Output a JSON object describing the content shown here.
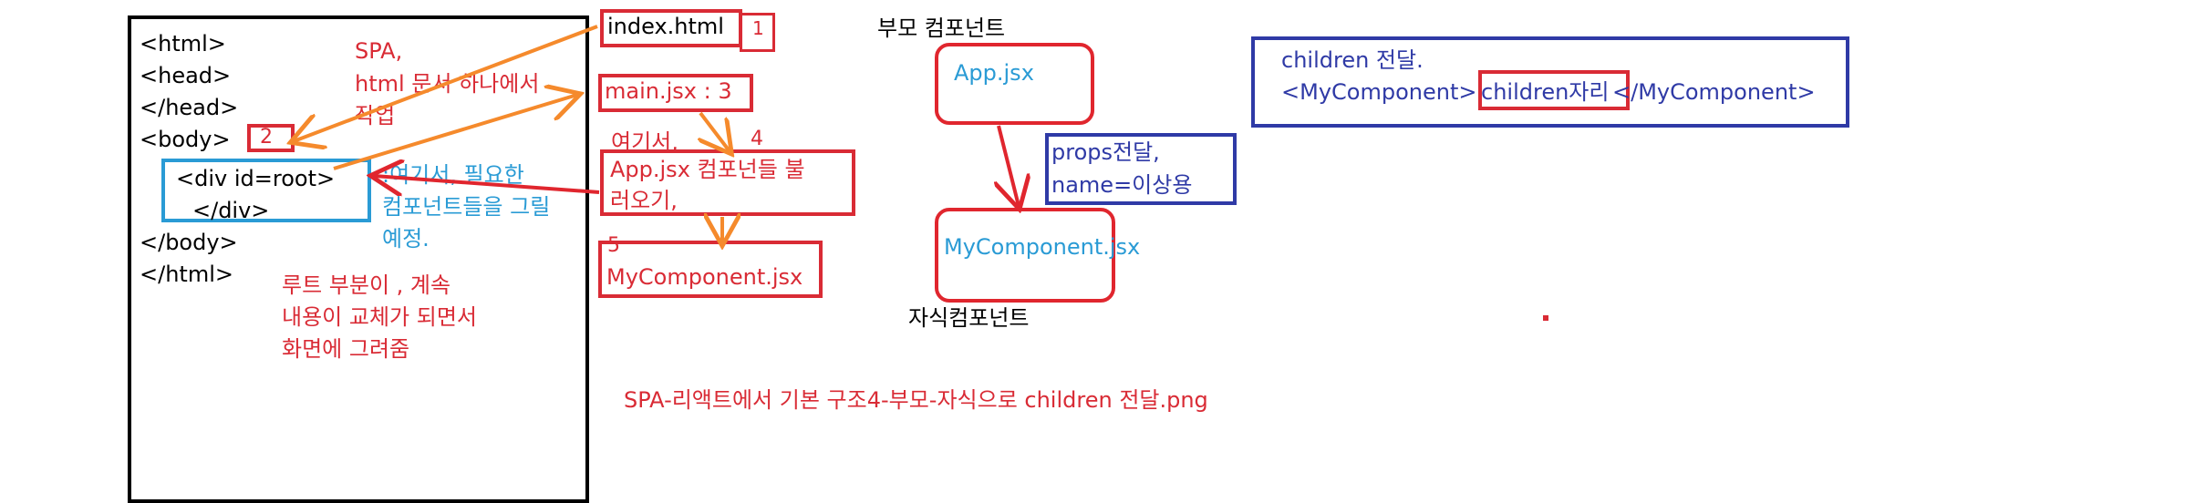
{
  "html_panel": {
    "lines": [
      "<html>",
      "<head>",
      "</head>",
      "<body>",
      "<div id=root>",
      "</div>",
      "</body>",
      "</html>"
    ],
    "marker": "2"
  },
  "notes": {
    "spa": [
      "SPA,",
      "html 문서 하나에서",
      "작업"
    ],
    "root_here": [
      ":여기서, 필요한",
      "컴포넌트들을 그릴",
      "예정."
    ],
    "root_desc": [
      "루트 부분이 , 계속",
      "내용이 교체가 되면서",
      "화면에 그려줌"
    ],
    "here_label": "여기서,",
    "step1": "1",
    "step4": "4",
    "step5": "5"
  },
  "flow": {
    "index_html": "index.html",
    "main_jsx": "main.jsx : 3",
    "app_jsx": [
      "App.jsx 컴포넌들 불",
      "러오기,"
    ],
    "my_component": "MyComponent.jsx"
  },
  "tree": {
    "parent_label": "부모 컴포넌트",
    "parent_file": "App.jsx",
    "props_note": [
      "props전달,",
      "name=이상용"
    ],
    "child_file": "MyComponent.jsx",
    "child_label": "자식컴포넌트"
  },
  "children_box": {
    "title": "children 전달.",
    "open_tag": "<MyComponent>",
    "slot": "children자리",
    "close_tag": "</MyComponent>"
  },
  "caption": "SPA-리액트에서 기본 구조4-부모-자식으로 children 전달.png",
  "colors": {
    "black": "#000000",
    "red": "#d92b35",
    "orange": "#f58a2c",
    "cyan": "#2a9bd5",
    "navy": "#2f3aa6"
  }
}
